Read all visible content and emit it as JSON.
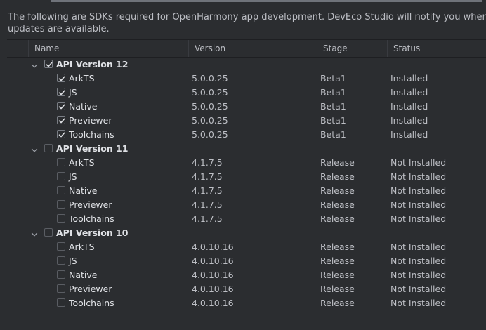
{
  "description": "The following are SDKs required for OpenHarmony app development. DevEco Studio will notify you when updates are available.",
  "columns": {
    "name": "Name",
    "version": "Version",
    "stage": "Stage",
    "status": "Status"
  },
  "groups": [
    {
      "label": "API Version 12",
      "checked": true,
      "items": [
        {
          "name": "ArkTS",
          "version": "5.0.0.25",
          "stage": "Beta1",
          "status": "Installed",
          "checked": true
        },
        {
          "name": "JS",
          "version": "5.0.0.25",
          "stage": "Beta1",
          "status": "Installed",
          "checked": true
        },
        {
          "name": "Native",
          "version": "5.0.0.25",
          "stage": "Beta1",
          "status": "Installed",
          "checked": true
        },
        {
          "name": "Previewer",
          "version": "5.0.0.25",
          "stage": "Beta1",
          "status": "Installed",
          "checked": true
        },
        {
          "name": "Toolchains",
          "version": "5.0.0.25",
          "stage": "Beta1",
          "status": "Installed",
          "checked": true
        }
      ]
    },
    {
      "label": "API Version 11",
      "checked": false,
      "items": [
        {
          "name": "ArkTS",
          "version": "4.1.7.5",
          "stage": "Release",
          "status": "Not Installed",
          "checked": false
        },
        {
          "name": "JS",
          "version": "4.1.7.5",
          "stage": "Release",
          "status": "Not Installed",
          "checked": false
        },
        {
          "name": "Native",
          "version": "4.1.7.5",
          "stage": "Release",
          "status": "Not Installed",
          "checked": false
        },
        {
          "name": "Previewer",
          "version": "4.1.7.5",
          "stage": "Release",
          "status": "Not Installed",
          "checked": false
        },
        {
          "name": "Toolchains",
          "version": "4.1.7.5",
          "stage": "Release",
          "status": "Not Installed",
          "checked": false
        }
      ]
    },
    {
      "label": "API Version 10",
      "checked": false,
      "items": [
        {
          "name": "ArkTS",
          "version": "4.0.10.16",
          "stage": "Release",
          "status": "Not Installed",
          "checked": false
        },
        {
          "name": "JS",
          "version": "4.0.10.16",
          "stage": "Release",
          "status": "Not Installed",
          "checked": false
        },
        {
          "name": "Native",
          "version": "4.0.10.16",
          "stage": "Release",
          "status": "Not Installed",
          "checked": false
        },
        {
          "name": "Previewer",
          "version": "4.0.10.16",
          "stage": "Release",
          "status": "Not Installed",
          "checked": false
        },
        {
          "name": "Toolchains",
          "version": "4.0.10.16",
          "stage": "Release",
          "status": "Not Installed",
          "checked": false
        }
      ]
    }
  ],
  "colors": {
    "background": "#2b2d30",
    "text": "#bcbec4",
    "checkbox_border": "#5a5d63"
  }
}
